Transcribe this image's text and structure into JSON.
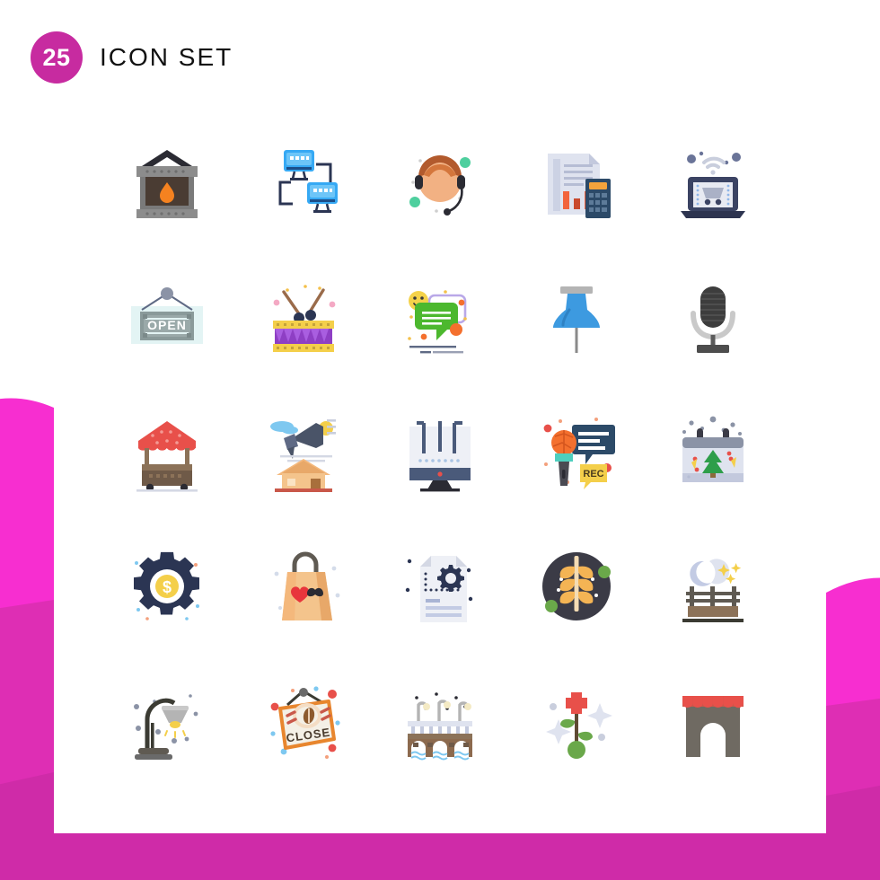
{
  "header": {
    "count": "25",
    "title": "ICON SET",
    "badge_color": "#c72ba0",
    "title_color": "#111111"
  },
  "theme": {
    "background": "#ffffff",
    "pink_light": "#f72ed0",
    "pink_mid": "#de2eb4",
    "pink_dark": "#cf2ba8"
  },
  "decor": [
    {
      "name": "pink-shape-left",
      "position": "left"
    },
    {
      "name": "pink-shape-right",
      "position": "right"
    },
    {
      "name": "pink-bar-bottom",
      "position": "bottom"
    }
  ],
  "grid": {
    "columns": 5,
    "rows": 5,
    "total": 25
  },
  "icons": [
    {
      "id": "fireplace",
      "label": "Fireplace",
      "row": 1,
      "col": 1
    },
    {
      "id": "network",
      "label": "Computer Network",
      "row": 1,
      "col": 2
    },
    {
      "id": "support-agent",
      "label": "Customer Support",
      "row": 1,
      "col": 3
    },
    {
      "id": "accounting",
      "label": "Accounting Report",
      "row": 1,
      "col": 4
    },
    {
      "id": "online-shopping",
      "label": "Online Shopping Laptop",
      "row": 1,
      "col": 5
    },
    {
      "id": "open-sign",
      "label": "Open Sign",
      "row": 2,
      "col": 1,
      "text": "OPEN"
    },
    {
      "id": "drum",
      "label": "Drum",
      "row": 2,
      "col": 2
    },
    {
      "id": "feedback-chat",
      "label": "Feedback Chat",
      "row": 2,
      "col": 3
    },
    {
      "id": "push-pin",
      "label": "Push Pin",
      "row": 2,
      "col": 4
    },
    {
      "id": "microphone",
      "label": "Microphone",
      "row": 2,
      "col": 5
    },
    {
      "id": "market-stall",
      "label": "Market Stall Cart",
      "row": 3,
      "col": 1
    },
    {
      "id": "advertising",
      "label": "Real Estate Advertising",
      "row": 3,
      "col": 2
    },
    {
      "id": "tv-antenna",
      "label": "Television Antenna",
      "row": 3,
      "col": 3
    },
    {
      "id": "recording",
      "label": "Recording Microphone",
      "row": 3,
      "col": 4,
      "text": "REC"
    },
    {
      "id": "christmas-calendar",
      "label": "Christmas Calendar",
      "row": 3,
      "col": 5
    },
    {
      "id": "money-gear",
      "label": "Money Management Gear",
      "row": 4,
      "col": 1
    },
    {
      "id": "shopping-bag-love",
      "label": "Shopping Bag Love",
      "row": 4,
      "col": 2
    },
    {
      "id": "document-settings",
      "label": "Document Settings",
      "row": 4,
      "col": 3
    },
    {
      "id": "wheat",
      "label": "Wheat Grain",
      "row": 4,
      "col": 4
    },
    {
      "id": "night-bench",
      "label": "Park Bench At Night",
      "row": 4,
      "col": 5
    },
    {
      "id": "desk-lamp",
      "label": "Desk Lamp",
      "row": 5,
      "col": 1
    },
    {
      "id": "close-sign",
      "label": "Close Sign",
      "row": 5,
      "col": 2,
      "text": "CLOSE"
    },
    {
      "id": "bridge",
      "label": "Bridge",
      "row": 5,
      "col": 3
    },
    {
      "id": "flower",
      "label": "Flower Plant",
      "row": 5,
      "col": 4
    },
    {
      "id": "shop-front",
      "label": "Shop Front",
      "row": 5,
      "col": 5
    }
  ]
}
